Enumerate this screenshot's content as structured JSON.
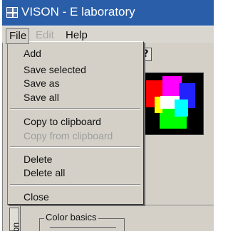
{
  "window": {
    "title": "VISON - E laboratory",
    "icon": "app-icon"
  },
  "menubar": {
    "items": [
      {
        "label": "File",
        "state": "open"
      },
      {
        "label": "Edit",
        "state": "disabled"
      },
      {
        "label": "Help",
        "state": "enabled"
      }
    ]
  },
  "dropdown": {
    "items": [
      {
        "label": "Add",
        "enabled": true
      },
      {
        "label": "Save selected",
        "enabled": true
      },
      {
        "label": "Save as",
        "enabled": true
      },
      {
        "label": "Save all",
        "enabled": true
      },
      {
        "label": "Copy to clipboard",
        "enabled": true
      },
      {
        "label": "Copy from clipboard",
        "enabled": false
      },
      {
        "label": "Delete",
        "enabled": true
      },
      {
        "label": "Delete all",
        "enabled": true
      },
      {
        "label": "Close",
        "enabled": true
      }
    ]
  },
  "toolbar": {
    "button_label": "?"
  },
  "bottom": {
    "vertical_tab": "ion",
    "group_title": "Color basics"
  },
  "colors": {
    "titlebar": "#2a5ea8",
    "window_face": "#d4d0c8",
    "preview_background": "#000000",
    "red": "#ff0000",
    "magenta": "#ff00ff",
    "blue": "#2222ff",
    "white": "#ffffff",
    "cyan": "#00ffff",
    "green": "#00ff00",
    "yellow": "#ffff00"
  }
}
